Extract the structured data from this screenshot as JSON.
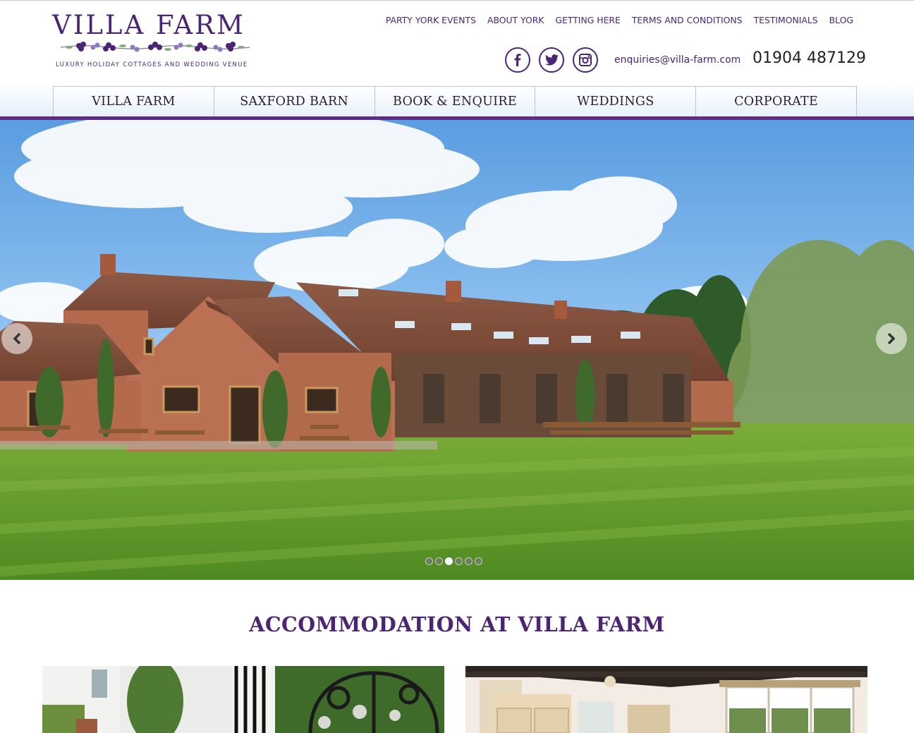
{
  "logo": {
    "title": "VILLA FARM",
    "tagline": "LUXURY HOLIDAY COTTAGES AND WEDDING VENUE"
  },
  "top_links": [
    "PARTY YORK EVENTS",
    "ABOUT YORK",
    "GETTING HERE",
    "TERMS AND CONDITIONS",
    "TESTIMONIALS",
    "BLOG"
  ],
  "social": [
    "facebook-icon",
    "twitter-icon",
    "instagram-icon"
  ],
  "contact": {
    "email": "enquiries@villa-farm.com",
    "phone": "01904 487129"
  },
  "nav": [
    "VILLA FARM",
    "SAXFORD BARN",
    "BOOK & ENQUIRE",
    "WEDDINGS",
    "CORPORATE"
  ],
  "slider": {
    "dot_count": 6,
    "active_dot": 3
  },
  "section": {
    "title": "ACCOMMODATION AT VILLA FARM"
  },
  "colors": {
    "brand_purple": "#4b2473",
    "nav_border": "#5b2d86"
  }
}
